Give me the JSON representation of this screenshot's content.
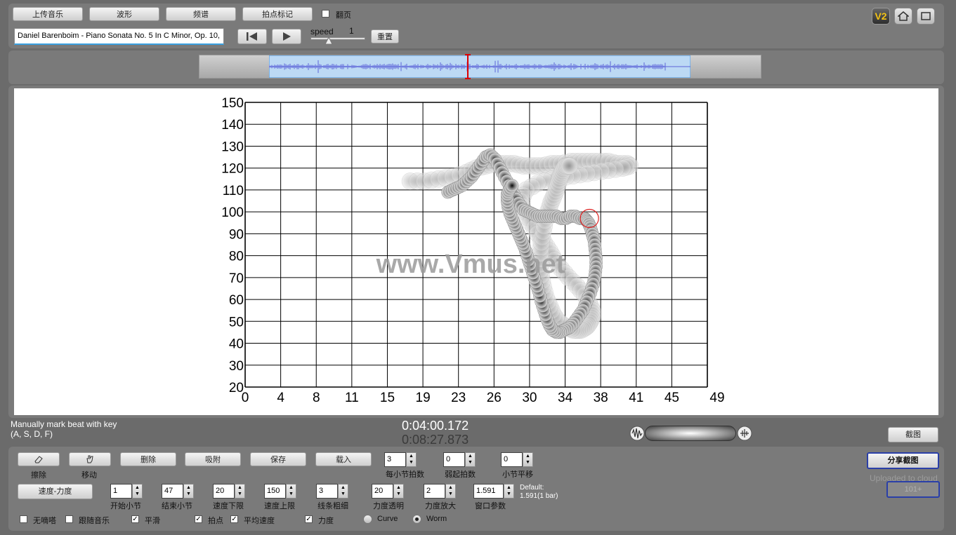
{
  "top": {
    "buttons": [
      "上传音乐",
      "波形",
      "频谱",
      "拍点标记"
    ],
    "page_flip_label": "翻页",
    "song_title": "Daniel Barenboim - Piano Sonata No. 5 In C Minor, Op. 10,",
    "speed_label": "speed",
    "speed_value": "1",
    "reset_label": "重置",
    "v2_label": "V2"
  },
  "status": {
    "hint_line1": "Manually mark beat with key",
    "hint_line2": "(A, S, D, F)",
    "time_current": "0:04:00.172",
    "time_total": "0:08:27.873",
    "screenshot_label": "截图"
  },
  "bottom": {
    "tool_buttons": [
      {
        "label": "擦除"
      },
      {
        "label": "移动"
      }
    ],
    "action_buttons": [
      "删除",
      "吸附",
      "保存",
      "载入"
    ],
    "row1_spinners": [
      {
        "value": "3",
        "label": "每小节拍数"
      },
      {
        "value": "0",
        "label": "弱起拍数"
      },
      {
        "value": "0",
        "label": "小节平移"
      }
    ],
    "mode_button": "速度-力度",
    "row2_spinners": [
      {
        "value": "1",
        "label": "开始小节"
      },
      {
        "value": "47",
        "label": "结束小节"
      },
      {
        "value": "20",
        "label": "速度下限"
      },
      {
        "value": "150",
        "label": "速度上限"
      },
      {
        "value": "3",
        "label": "线条粗细"
      },
      {
        "value": "20",
        "label": "力度透明"
      },
      {
        "value": "2",
        "label": "力度放大"
      },
      {
        "value": "1.591",
        "label": "窗口参数"
      }
    ],
    "default_line1": "Default:",
    "default_line2": "1.591(1 bar)",
    "checkboxes": [
      {
        "label": "无嘀嗒",
        "checked": false
      },
      {
        "label": "跟随音乐",
        "checked": false
      },
      {
        "label": "平滑",
        "checked": true
      },
      {
        "label": "拍点",
        "checked": true
      },
      {
        "label": "平均速度",
        "checked": true
      },
      {
        "label": "力度",
        "checked": true
      }
    ],
    "radios": [
      {
        "label": "Curve",
        "checked": false
      },
      {
        "label": "Worm",
        "checked": true
      }
    ],
    "share_button": "分享截图",
    "uploaded_text": "Uploaded to cloud",
    "faded_button": "101+"
  },
  "watermark": "www.Vmus.net",
  "chart_data": {
    "type": "scatter",
    "title": "",
    "xlabel": "",
    "ylabel": "",
    "x_ticks": [
      "0",
      "4",
      "8",
      "11",
      "15",
      "19",
      "23",
      "26",
      "30",
      "34",
      "38",
      "41",
      "45",
      "49"
    ],
    "y_ticks": [
      "150",
      "140",
      "130",
      "120",
      "110",
      "100",
      "90",
      "80",
      "70",
      "60",
      "50",
      "40",
      "30",
      "20"
    ],
    "xlim": [
      0,
      49
    ],
    "ylim": [
      20,
      150
    ],
    "series": [
      {
        "style": "faded",
        "x": [
          17.5,
          19,
          20.5,
          22,
          23.5,
          24.5,
          25.5,
          26.5,
          27.5,
          28.5,
          29.5,
          30.5,
          31.5,
          32.5,
          33.5,
          34.5,
          35.5,
          36.5,
          37.5,
          38.5,
          39.5,
          40.5,
          40.8,
          40,
          38.5,
          37,
          35.5,
          34,
          32.5,
          31,
          29.8,
          29.2,
          29.6,
          30.3,
          31,
          31.7,
          32.3,
          32.8,
          33.5,
          34.3,
          35.2,
          36,
          36.5,
          36.8,
          36.8,
          36.6,
          36.3,
          36,
          35.6,
          35.2,
          34.8,
          34.3,
          33.8,
          33.2,
          32.7,
          32.3,
          31.9,
          31.6,
          31.4,
          31.3,
          31.3,
          31.4,
          31.6,
          31.8,
          32.1,
          32.4,
          32.7,
          33,
          33.2,
          33.4,
          33.6,
          33.8,
          34,
          34.2,
          34.4
        ],
        "y": [
          114,
          114,
          115,
          116,
          118,
          120,
          121,
          122,
          122,
          122,
          121,
          121,
          121,
          122,
          122,
          123,
          123,
          123,
          123,
          123,
          122,
          122,
          121,
          120,
          119,
          118,
          117,
          116,
          115,
          113,
          110,
          105,
          100,
          95,
          90,
          86,
          82,
          78,
          74,
          70,
          66,
          62,
          58,
          55,
          52,
          50,
          48,
          47,
          46,
          46,
          46,
          47,
          48,
          50,
          53,
          57,
          61,
          66,
          71,
          76,
          81,
          86,
          91,
          96,
          100,
          104,
          107,
          110,
          113,
          116,
          118,
          120,
          121,
          121,
          121
        ]
      },
      {
        "style": "solid",
        "x": [
          21.5,
          22,
          22.5,
          23,
          23.5,
          24,
          24.5,
          25,
          25.5,
          26,
          26.5,
          27,
          27.5,
          28,
          28.5,
          29,
          29.5,
          30,
          30.5,
          31,
          31.5,
          32,
          32.5,
          33,
          33.5,
          34,
          34.5,
          35,
          35.5,
          36,
          36.2,
          36.4,
          36.6,
          36.8,
          37,
          37.1,
          37.2,
          37.2,
          37.1,
          36.9,
          36.6,
          36.2,
          35.8,
          35.3,
          34.8,
          34.3,
          33.8,
          33.4,
          33,
          32.6,
          32.3,
          32,
          31.7,
          31.4,
          31.1,
          30.8,
          30.5,
          30.2,
          29.9,
          29.6,
          29.3,
          29,
          28.7,
          28.4,
          28.1,
          27.9,
          27.8,
          27.8,
          28,
          28.3
        ],
        "y": [
          109,
          110,
          111,
          112,
          114,
          116,
          119,
          122,
          125,
          126,
          124,
          120,
          116,
          112,
          108,
          104,
          101,
          100,
          99,
          98,
          98,
          98,
          98,
          98,
          97,
          97,
          98,
          98,
          97,
          97,
          96,
          95,
          93,
          90,
          87,
          83,
          79,
          75,
          71,
          67,
          63,
          59,
          55,
          52,
          49,
          47,
          46,
          45,
          45,
          46,
          48,
          51,
          55,
          59,
          64,
          68,
          72,
          76,
          80,
          84,
          87,
          90,
          93,
          96,
          99,
          102,
          105,
          108,
          110,
          112
        ]
      }
    ],
    "marker_highlight": {
      "x": 36.5,
      "y": 97
    }
  }
}
